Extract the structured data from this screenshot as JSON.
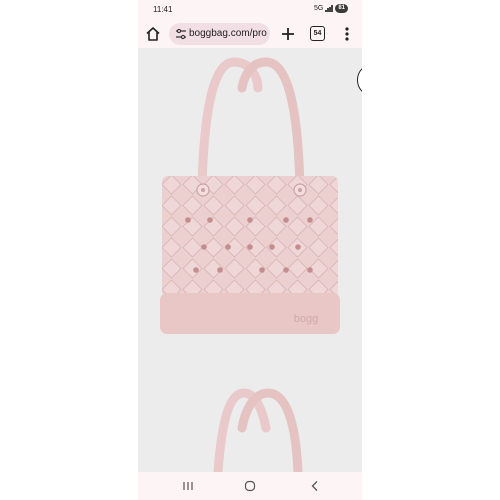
{
  "status_bar": {
    "time": "11:41",
    "network": "5G",
    "battery": "81"
  },
  "browser": {
    "url": "boggbag.com/pro",
    "tab_count": "54",
    "icons": [
      "home-icon",
      "tune-icon",
      "plus-icon",
      "tabs-icon",
      "more-vert-icon"
    ]
  },
  "product": {
    "brand_mark": "bogg",
    "color": "#ebcfcf",
    "background": "#ececec"
  },
  "nav_bar": {
    "icons": [
      "recents-icon",
      "home-circle-icon",
      "back-icon"
    ]
  }
}
